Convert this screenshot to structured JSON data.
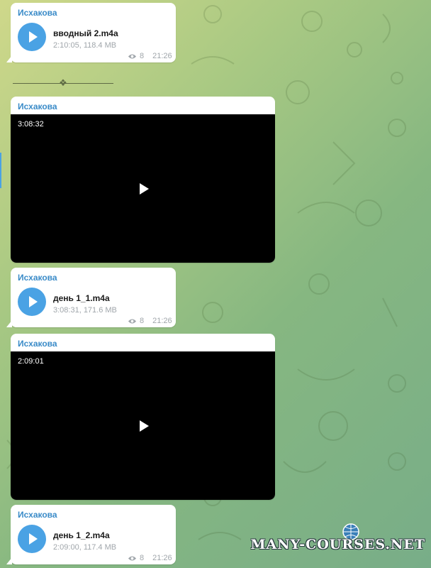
{
  "messages": [
    {
      "type": "audio",
      "sender": "Исхакова",
      "file_name": "вводный 2.m4a",
      "file_meta": "2:10:05, 118.4 MB",
      "views": "8",
      "time": "21:26"
    },
    {
      "type": "video",
      "sender": "Исхакова",
      "duration": "3:08:32"
    },
    {
      "type": "audio",
      "sender": "Исхакова",
      "file_name": "день 1_1.m4a",
      "file_meta": "3:08:31, 171.6 MB",
      "views": "8",
      "time": "21:26"
    },
    {
      "type": "video",
      "sender": "Исхакова",
      "duration": "2:09:01"
    },
    {
      "type": "audio",
      "sender": "Исхакова",
      "file_name": "день 1_2.m4a",
      "file_meta": "2:09:00, 117.4 MB",
      "views": "8",
      "time": "21:26"
    }
  ],
  "watermark": "MANY-COURSES.NET",
  "colors": {
    "accent": "#4aa2e4",
    "sender": "#3a8bc8",
    "meta": "#a0a6ab"
  }
}
